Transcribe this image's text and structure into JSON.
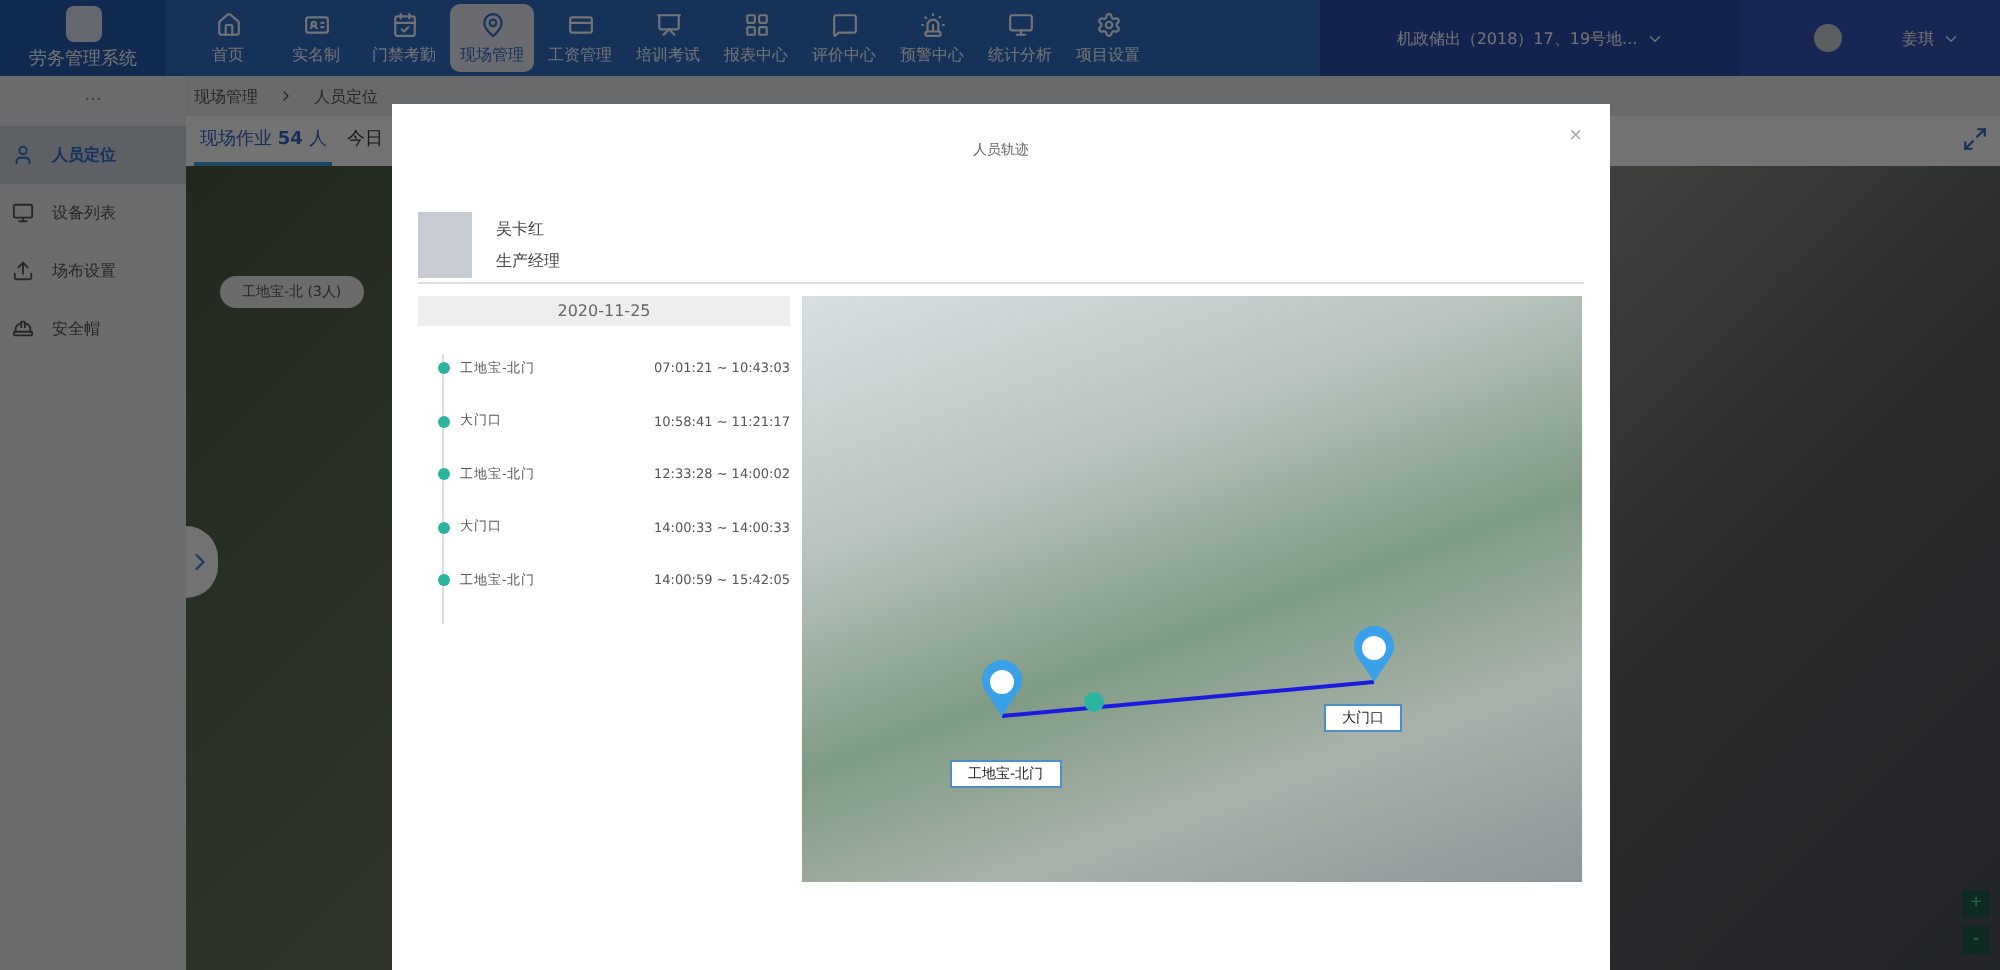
{
  "app": {
    "name": "劳务管理系统"
  },
  "nav": [
    {
      "label": "首页",
      "selected": false
    },
    {
      "label": "实名制",
      "selected": false
    },
    {
      "label": "门禁考勤",
      "selected": false
    },
    {
      "label": "现场管理",
      "selected": true
    },
    {
      "label": "工资管理",
      "selected": false
    },
    {
      "label": "培训考试",
      "selected": false
    },
    {
      "label": "报表中心",
      "selected": false
    },
    {
      "label": "评价中心",
      "selected": false
    },
    {
      "label": "预警中心",
      "selected": false
    },
    {
      "label": "统计分析",
      "selected": false
    },
    {
      "label": "项目设置",
      "selected": false
    }
  ],
  "project_selector": {
    "value": "机政储出（2018）17、19号地..."
  },
  "user": {
    "name": "姜琪"
  },
  "sidebar": {
    "more": "...",
    "items": [
      {
        "label": "人员定位",
        "selected": true
      },
      {
        "label": "设备列表",
        "selected": false
      },
      {
        "label": "场布设置",
        "selected": false
      },
      {
        "label": "安全帽",
        "selected": false
      }
    ]
  },
  "breadcrumb": [
    "现场管理",
    "人员定位"
  ],
  "tabs": [
    {
      "label": "现场作业 **54** 人",
      "selected": true
    },
    {
      "label": "今日",
      "selected": false
    }
  ],
  "map": {
    "marker_label": "工地宝-北 (3人)",
    "zoom_in": "+",
    "zoom_out": "-"
  },
  "modal": {
    "title": "人员轨迹",
    "close": "×",
    "person": {
      "name": "吴卡红",
      "role": "生产经理"
    },
    "date": "2020-11-25",
    "track": [
      {
        "place": "工地宝-北门",
        "time": "07:01:21 ~ 10:43:03"
      },
      {
        "place": "大门口",
        "time": "10:58:41 ~ 11:21:17"
      },
      {
        "place": "工地宝-北门",
        "time": "12:33:28 ~ 14:00:02"
      },
      {
        "place": "大门口",
        "time": "14:00:33 ~ 14:00:33"
      },
      {
        "place": "工地宝-北门",
        "time": "14:00:59 ~ 15:42:05"
      }
    ],
    "route_points": [
      {
        "label": "工地宝-北门"
      },
      {
        "label": "大门口"
      }
    ]
  }
}
